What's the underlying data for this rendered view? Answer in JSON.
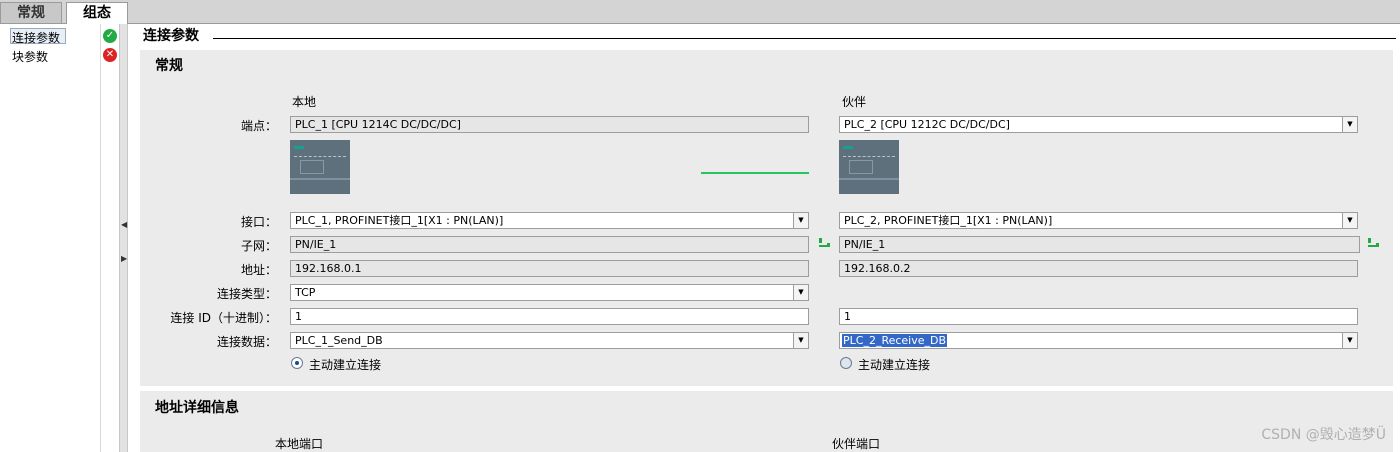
{
  "tabs": [
    {
      "label": "常规",
      "active": false
    },
    {
      "label": "组态",
      "active": true
    }
  ],
  "nav": {
    "items": [
      {
        "label": "连接参数",
        "status": "ok",
        "status_color": "#22aa44"
      },
      {
        "label": "块参数",
        "status": "error",
        "status_color": "#dd2222"
      }
    ]
  },
  "header": {
    "title": "连接参数"
  },
  "general": {
    "title": "常规",
    "local_heading": "本地",
    "partner_heading": "伙伴",
    "labels": {
      "endpoint": "端点：",
      "interface": "接口：",
      "subnet": "子网：",
      "address": "地址：",
      "conn_type": "连接类型：",
      "conn_id": "连接 ID（十进制）：",
      "conn_data": "连接数据："
    },
    "local": {
      "endpoint": "PLC_1 [CPU 1214C DC/DC/DC]",
      "interface": "PLC_1, PROFINET接口_1[X1 : PN(LAN)]",
      "subnet": "PN/IE_1",
      "address": "192.168.0.1",
      "conn_type": "TCP",
      "conn_id": "1",
      "conn_data": "PLC_1_Send_DB",
      "active_connect_label": "主动建立连接",
      "active_connect_checked": true
    },
    "partner": {
      "endpoint": "PLC_2 [CPU 1212C DC/DC/DC]",
      "interface": "PLC_2, PROFINET接口_1[X1 : PN(LAN)]",
      "subnet": "PN/IE_1",
      "address": "192.168.0.2",
      "conn_id": "1",
      "conn_data": "PLC_2_Receive_DB",
      "active_connect_label": "主动建立连接",
      "active_connect_checked": false
    },
    "link_color": "#22c55e"
  },
  "address_details": {
    "title": "地址详细信息",
    "local_port_heading": "本地端口",
    "partner_port_heading": "伙伴端口"
  },
  "watermark": "CSDN @毁心造梦Ü"
}
